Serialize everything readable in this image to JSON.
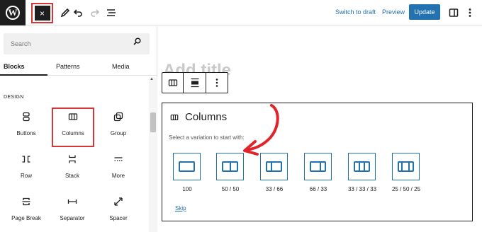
{
  "topbar": {
    "logo_text": "W",
    "close_icon": "×",
    "switch_to_draft": "Switch to draft",
    "preview": "Preview",
    "update": "Update"
  },
  "sidebar": {
    "search": {
      "placeholder": "Search"
    },
    "tabs": [
      {
        "label": "Blocks",
        "active": true
      },
      {
        "label": "Patterns",
        "active": false
      },
      {
        "label": "Media",
        "active": false
      }
    ],
    "section_title": "DESIGN",
    "blocks": [
      {
        "label": "Buttons",
        "icon": "buttons-icon"
      },
      {
        "label": "Columns",
        "icon": "columns-icon",
        "highlighted": true
      },
      {
        "label": "Group",
        "icon": "group-icon"
      },
      {
        "label": "Row",
        "icon": "row-icon"
      },
      {
        "label": "Stack",
        "icon": "stack-icon"
      },
      {
        "label": "More",
        "icon": "more-icon"
      },
      {
        "label": "Page Break",
        "icon": "page-break-icon"
      },
      {
        "label": "Separator",
        "icon": "separator-icon"
      },
      {
        "label": "Spacer",
        "icon": "spacer-icon"
      }
    ]
  },
  "canvas": {
    "title_placeholder": "Add title",
    "columns_block": {
      "title": "Columns",
      "description": "Select a variation to start with:",
      "variations": [
        {
          "label": "100"
        },
        {
          "label": "50 / 50"
        },
        {
          "label": "33 / 66"
        },
        {
          "label": "66 / 33"
        },
        {
          "label": "33 / 33 / 33"
        },
        {
          "label": "25 / 50 / 25"
        }
      ],
      "skip": "Skip"
    }
  },
  "colors": {
    "accent": "#2271b1",
    "highlight": "#d63638",
    "dark": "#1e1e1e"
  }
}
